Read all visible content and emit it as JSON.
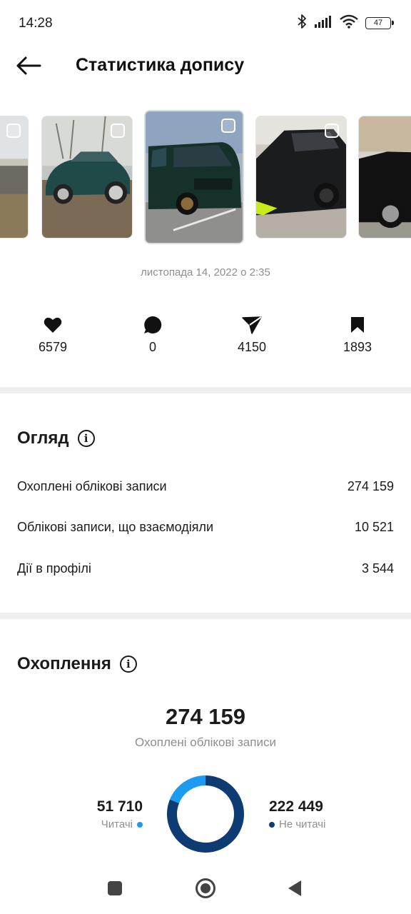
{
  "status_bar": {
    "time": "14:28",
    "battery": "47",
    "icons": [
      "bluetooth-icon",
      "signal-icon",
      "wifi-icon",
      "battery-icon"
    ]
  },
  "header": {
    "title": "Статистика допису",
    "back_icon": "arrow-left-icon"
  },
  "carousel": {
    "items": [
      {
        "label": "post-thumbnail-1",
        "scene": "car-partial"
      },
      {
        "label": "post-thumbnail-2",
        "scene": "green-sedan"
      },
      {
        "label": "post-thumbnail-3",
        "scene": "green-van",
        "selected": true
      },
      {
        "label": "post-thumbnail-4",
        "scene": "black-suv"
      },
      {
        "label": "post-thumbnail-5",
        "scene": "black-car-partial"
      }
    ]
  },
  "post": {
    "date": "листопада 14, 2022 о 2:35"
  },
  "stats": {
    "likes": "6579",
    "comments": "0",
    "shares": "4150",
    "saves": "1893"
  },
  "overview": {
    "title": "Огляд",
    "rows": [
      {
        "label": "Охоплені облікові записи",
        "value": "274 159"
      },
      {
        "label": "Облікові записи, що взаємодіяли",
        "value": "10 521"
      },
      {
        "label": "Дії в профілі",
        "value": "3 544"
      }
    ]
  },
  "reach": {
    "title": "Охоплення",
    "total": "274 159",
    "subtitle": "Охоплені облікові записи",
    "followers": {
      "value": "51 710",
      "label": "Читачі",
      "color": "#1d9bf0"
    },
    "non_followers": {
      "value": "222 449",
      "label": "Не читачі",
      "color": "#0f3b73"
    }
  },
  "chart_data": {
    "type": "pie",
    "categories": [
      "Читачі",
      "Не читачі"
    ],
    "values": [
      51710,
      222449
    ],
    "colors": [
      "#1d9bf0",
      "#0f3b73"
    ],
    "title": "274 159",
    "subtitle": "Охоплені облікові записи"
  },
  "nav": {
    "items": [
      "recent-apps-icon",
      "home-icon",
      "back-icon"
    ]
  },
  "colors": {
    "accent_light": "#1d9bf0",
    "accent_dark": "#0f3b73",
    "muted_text": "#8e8e8e",
    "divider": "#efefef"
  }
}
